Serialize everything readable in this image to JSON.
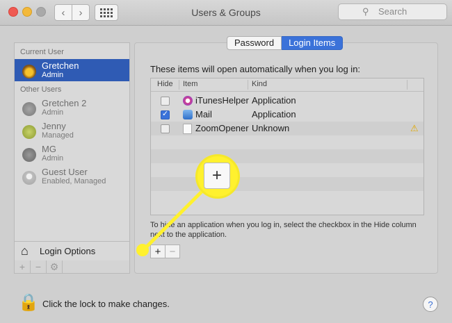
{
  "window": {
    "title": "Users & Groups",
    "search_placeholder": "Search"
  },
  "sidebar": {
    "current_user_label": "Current User",
    "other_users_label": "Other Users",
    "users": [
      {
        "name": "Gretchen",
        "role": "Admin",
        "selected": true
      },
      {
        "name": "Gretchen 2",
        "role": "Admin"
      },
      {
        "name": "Jenny",
        "role": "Managed"
      },
      {
        "name": "MG",
        "role": "Admin"
      },
      {
        "name": "Guest User",
        "role": "Enabled, Managed"
      }
    ],
    "login_options": "Login Options"
  },
  "tabs": [
    {
      "label": "Password",
      "active": false
    },
    {
      "label": "Login Items",
      "active": true
    }
  ],
  "intro": "These items will open automatically when you log in:",
  "table": {
    "headers": [
      "Hide",
      "Item",
      "Kind"
    ],
    "rows": [
      {
        "hide": false,
        "item": "iTunesHelper",
        "kind": "Application"
      },
      {
        "hide": true,
        "item": "Mail",
        "kind": "Application"
      },
      {
        "hide": false,
        "item": "ZoomOpener",
        "kind": "Unknown",
        "warning": true
      }
    ]
  },
  "hint": "To hide an application when you log in, select the checkbox in the Hide column next to the application.",
  "controls": {
    "add": "+",
    "remove": "−"
  },
  "callout_symbol": "+",
  "lock_text": "Click the lock to make changes.",
  "help": "?",
  "colors": {
    "accent": "#3b72d9",
    "selection": "#2f5bb4",
    "callout": "#fff12e"
  }
}
